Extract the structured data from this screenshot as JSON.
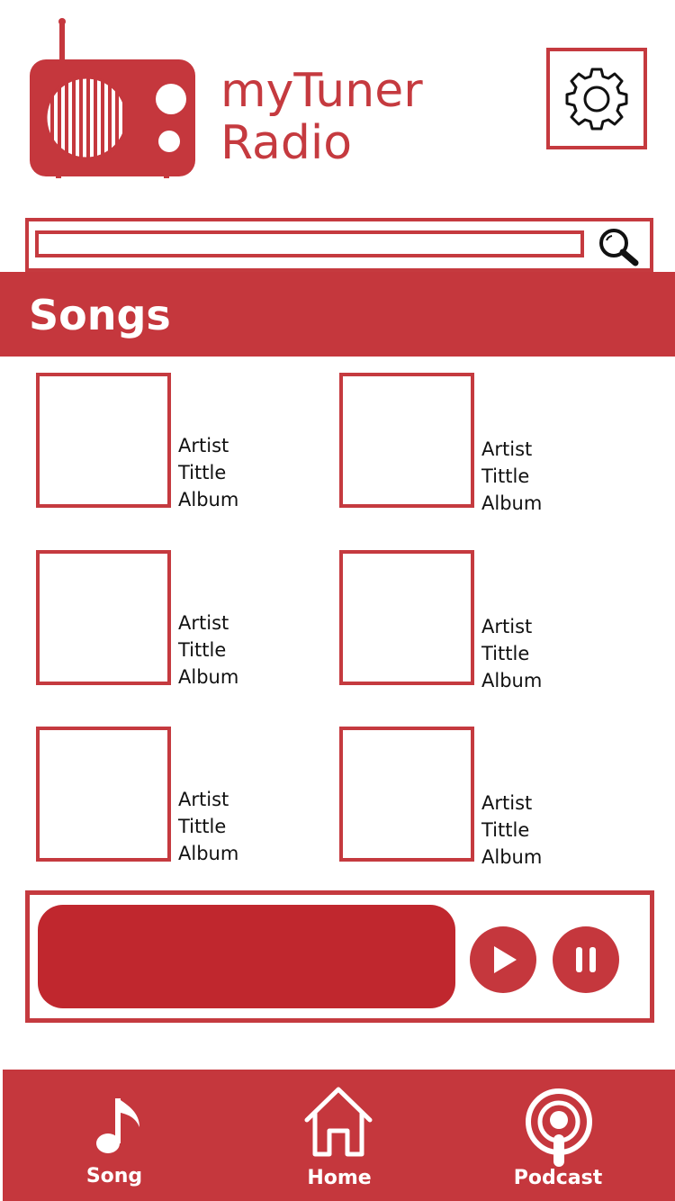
{
  "app": {
    "brand_line1": "myTuner",
    "brand_line2": "Radio"
  },
  "colors": {
    "accent": "#c5373d",
    "accent_dark": "#c0272e",
    "background": "#ffffff",
    "text": "#111111"
  },
  "header": {
    "settings_icon": "gear-icon",
    "logo_icon": "radio-icon"
  },
  "search": {
    "value": "",
    "placeholder": "",
    "icon": "search-icon"
  },
  "section": {
    "title": "Songs"
  },
  "songs": [
    {
      "artist": "Artist",
      "title": "Tittle",
      "album": "Album"
    },
    {
      "artist": "Artist",
      "title": "Tittle",
      "album": "Album"
    },
    {
      "artist": "Artist",
      "title": "Tittle",
      "album": "Album"
    },
    {
      "artist": "Artist",
      "title": "Tittle",
      "album": "Album"
    },
    {
      "artist": "Artist",
      "title": "Tittle",
      "album": "Album"
    },
    {
      "artist": "Artist",
      "title": "Tittle",
      "album": "Album"
    }
  ],
  "player": {
    "play_icon": "play-icon",
    "pause_icon": "pause-icon"
  },
  "nav": {
    "song": {
      "label": "Song",
      "icon": "music-note-icon"
    },
    "home": {
      "label": "Home",
      "icon": "home-icon"
    },
    "podcast": {
      "label": "Podcast",
      "icon": "podcast-icon"
    }
  }
}
